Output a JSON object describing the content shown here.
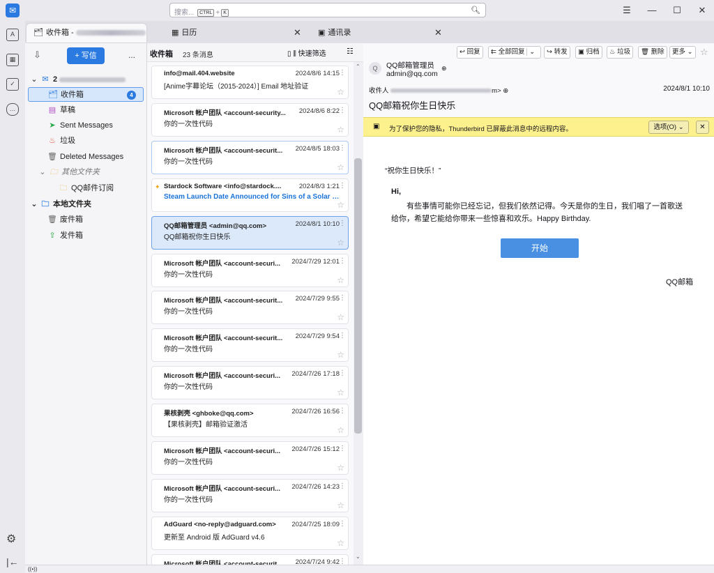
{
  "search": {
    "placeholder": "搜索...",
    "kbd1": "CTRL",
    "plus": "+",
    "kbd2": "K"
  },
  "icons": {
    "app_logo": "thunderbird-icon",
    "mag": "search-icon",
    "menu": "hamburger-icon",
    "min": "minimize-icon",
    "max": "maximize-icon",
    "close": "close-icon"
  },
  "window": {
    "menu_glyph": "☰",
    "min_glyph": "—",
    "max_glyph": "☐",
    "close_glyph": "✕"
  },
  "tabs": [
    {
      "label": "收件箱 -"
    },
    {
      "label": "日历"
    },
    {
      "label": "通讯录"
    }
  ],
  "folderpane": {
    "write_label": "+ 写信",
    "more": "...",
    "account": "2",
    "folders": [
      {
        "label": "收件箱",
        "badge": "4"
      },
      {
        "label": "草稿"
      },
      {
        "label": "Sent Messages"
      },
      {
        "label": "垃圾"
      },
      {
        "label": "Deleted Messages"
      },
      {
        "label": "其他文件夹"
      },
      {
        "label": "QQ邮件订阅"
      },
      {
        "label": "本地文件夹"
      },
      {
        "label": "废件箱"
      },
      {
        "label": "发件箱"
      }
    ]
  },
  "threadpane": {
    "title": "收件箱",
    "count": "23 条消息",
    "quickfilter": "快速筛选",
    "messages": [
      {
        "from": "info@mail.404.website",
        "date": "2024/8/6 14:15",
        "subject": "[Anime字幕论坛（2015-2024）] Email 地址验证"
      },
      {
        "from": "Microsoft 帐户团队 <account-security...",
        "date": "2024/8/6 8:22",
        "subject": "你的一次性代码"
      },
      {
        "from": "Microsoft 帐户团队 <account-securit...",
        "date": "2024/8/5 18:03",
        "subject": "你的一次性代码"
      },
      {
        "from": "Stardock Software <info@stardock....",
        "date": "2024/8/3 1:21",
        "subject": "Steam Launch Date Announced for Sins of a Solar E..."
      },
      {
        "from": "QQ邮箱管理员 <admin@qq.com>",
        "date": "2024/8/1 10:10",
        "subject": "QQ邮箱祝你生日快乐"
      },
      {
        "from": "Microsoft 帐户团队 <account-securi...",
        "date": "2024/7/29 12:01",
        "subject": "你的一次性代码"
      },
      {
        "from": "Microsoft 帐户团队 <account-securit...",
        "date": "2024/7/29 9:55",
        "subject": "你的一次性代码"
      },
      {
        "from": "Microsoft 帐户团队 <account-securit...",
        "date": "2024/7/29 9:54",
        "subject": "你的一次性代码"
      },
      {
        "from": "Microsoft 帐户团队 <account-securi...",
        "date": "2024/7/26 17:18",
        "subject": "你的一次性代码"
      },
      {
        "from": "果核剥壳 <ghboke@qq.com>",
        "date": "2024/7/26 16:56",
        "subject": "【果核剥壳】邮箱验证激活"
      },
      {
        "from": "Microsoft 帐户团队 <account-securi...",
        "date": "2024/7/26 15:12",
        "subject": "你的一次性代码"
      },
      {
        "from": "Microsoft 帐户团队 <account-securi...",
        "date": "2024/7/26 14:23",
        "subject": "你的一次性代码"
      },
      {
        "from": "AdGuard <no-reply@adguard.com>",
        "date": "2024/7/25 18:09",
        "subject": "更新至 Android 版 AdGuard v4.6"
      },
      {
        "from": "Microsoft 帐户团队 <account-securit...",
        "date": "2024/7/24 9:42",
        "subject": ""
      }
    ]
  },
  "message": {
    "toolbar": {
      "reply": "回复",
      "reply_all": "全部回复",
      "forward": "转发",
      "archive": "归档",
      "junk": "垃圾",
      "delete": "删除",
      "more": "更多"
    },
    "sender_name": "QQ邮箱管理员",
    "sender_email": "admin@qq.com",
    "to_label": "收件人",
    "to_tail": "m>",
    "date": "2024/8/1 10:10",
    "subject": "QQ邮箱祝你生日快乐",
    "notice": "为了保护您的隐私，Thunderbird 已屏蔽此消息中的远程内容。",
    "options": "选项(O)",
    "body": {
      "heading": "“祝你生日快乐！”",
      "greeting": "Hi,",
      "para": "有些事情可能你已经忘记，但我们依然记得。今天是你的生日，我们唱了一首歌送给你，希望它能给你带来一些惊喜和欢乐。Happy Birthday.",
      "button": "开始",
      "signature": "QQ邮箱"
    }
  },
  "statusbar": {
    "text": "((•))"
  }
}
